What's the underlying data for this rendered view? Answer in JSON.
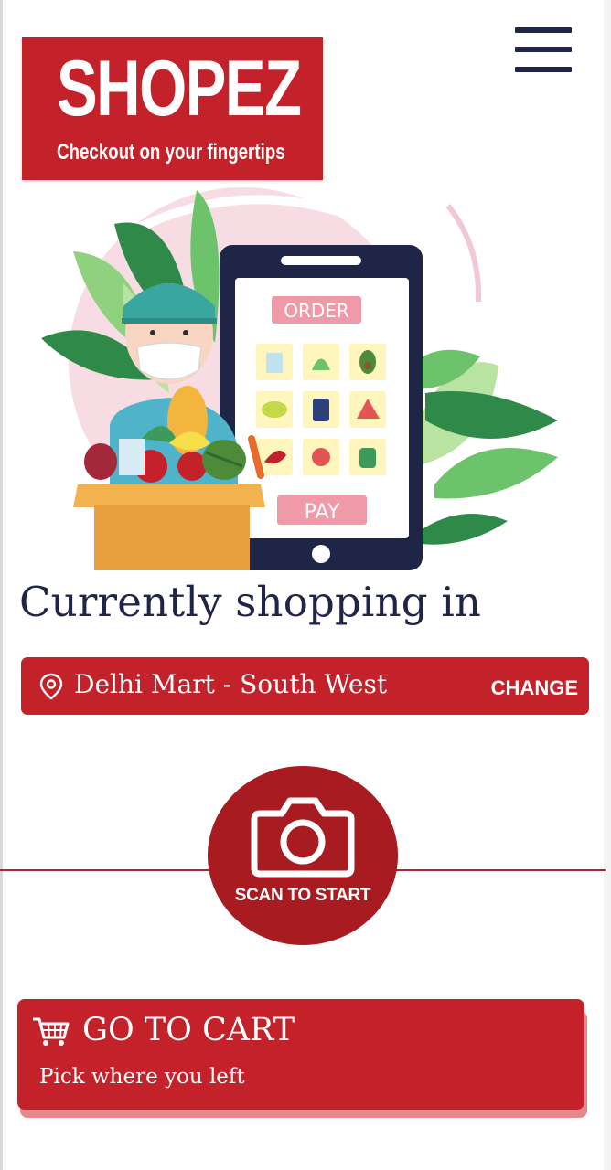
{
  "brand": {
    "name": "SHOPEZ",
    "tagline": "Checkout on your fingertips"
  },
  "menu": {
    "icon": "hamburger-menu-icon"
  },
  "hero": {
    "phone_order_label": "ORDER",
    "phone_pay_label": "PAY"
  },
  "shopping": {
    "heading": "Currently shopping in",
    "store_name": "Delhi Mart - South West",
    "change_label": "CHANGE",
    "location_icon": "location-pin-icon"
  },
  "scan": {
    "label": "SCAN TO START",
    "icon": "camera-icon"
  },
  "cart": {
    "title": "GO TO CART",
    "subtitle": "Pick where you left",
    "icon": "shopping-cart-icon"
  },
  "colors": {
    "brand_red": "#c4222a",
    "scan_red": "#a71b21",
    "navy": "#1f2547"
  }
}
